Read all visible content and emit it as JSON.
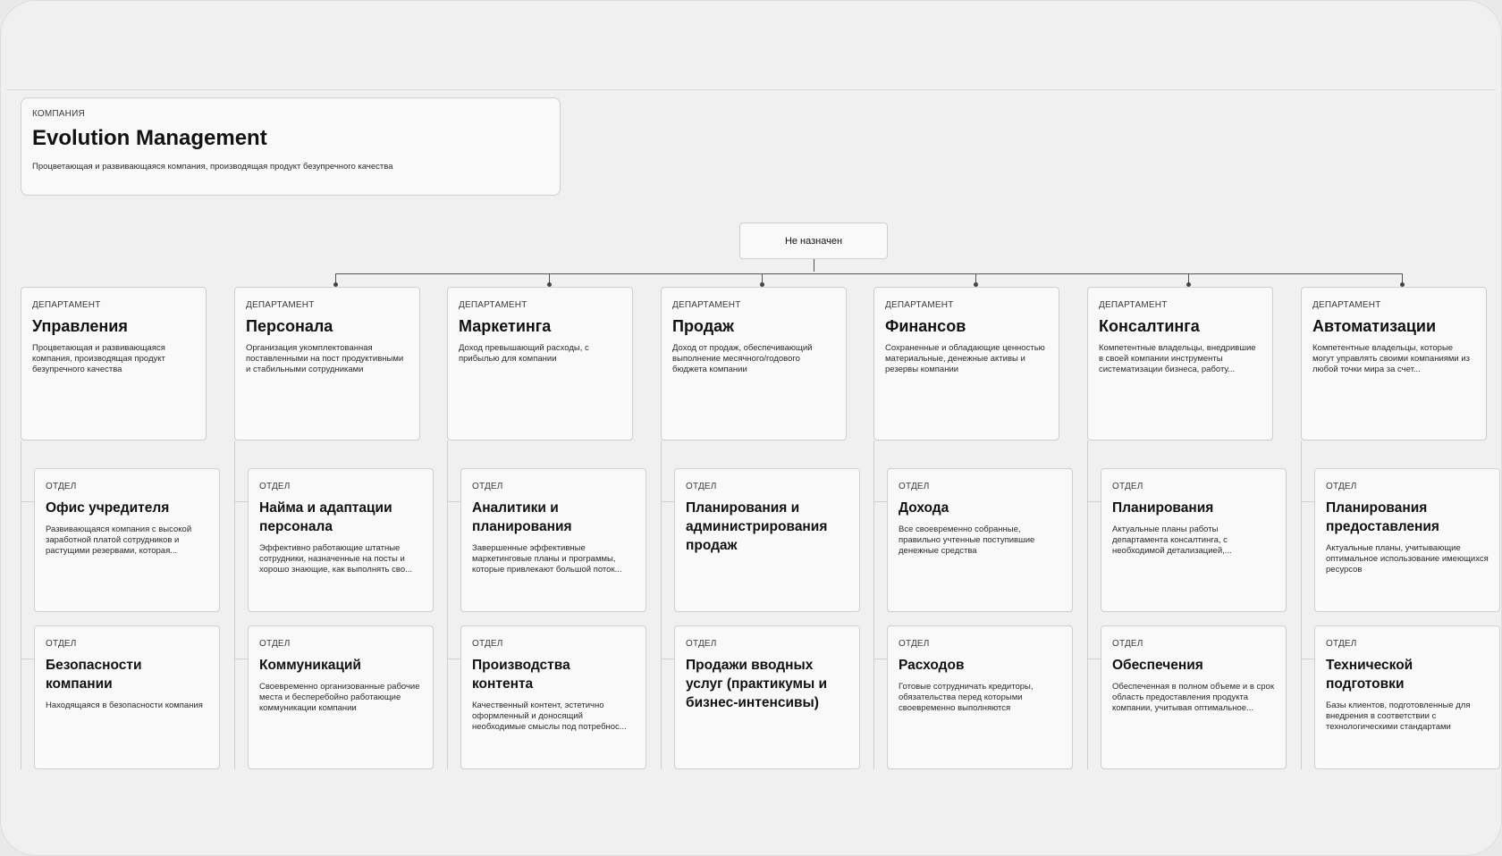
{
  "company": {
    "kind": "КОМПАНИЯ",
    "name": "Evolution Management",
    "description": "Процветающая и развивающаяся компания, производящая продукт безупречного качества"
  },
  "unassigned": "Не назначен",
  "departments": [
    {
      "kind": "ДЕПАРТАМЕНТ",
      "name": "Управления",
      "description": "Процветающая и развивающаяся компания, производящая продукт безупречного качества",
      "units": [
        {
          "kind": "ОТДЕЛ",
          "name": "Офис учредителя",
          "description": "Развивающаяся компания с высокой заработной платой сотрудников и растущими резервами, которая..."
        },
        {
          "kind": "ОТДЕЛ",
          "name": "Безопасности компании",
          "description": "Находящаяся в безопасности компания"
        }
      ]
    },
    {
      "kind": "ДЕПАРТАМЕНТ",
      "name": "Персонала",
      "description": "Организация укомплектованная поставленными на пост продуктивными и стабильными сотрудниками",
      "units": [
        {
          "kind": "ОТДЕЛ",
          "name": "Найма и адаптации персонала",
          "description": "Эффективно работающие штатные сотрудники, назначенные на посты и хорошо знающие, как выполнять сво..."
        },
        {
          "kind": "ОТДЕЛ",
          "name": "Коммуникаций",
          "description": "Своевременно организованные рабочие места и бесперебойно работающие коммуникации компании"
        }
      ]
    },
    {
      "kind": "ДЕПАРТАМЕНТ",
      "name": "Маркетинга",
      "description": "Доход превышающий расходы, с прибылью для компании",
      "units": [
        {
          "kind": "ОТДЕЛ",
          "name": "Аналитики и планирования",
          "description": "Завершенные эффективные маркетинговые планы и программы, которые привлекают большой поток..."
        },
        {
          "kind": "ОТДЕЛ",
          "name": "Производства контента",
          "description": "Качественный контент, эстетично оформленный и доносящий необходимые смыслы под потребнос..."
        }
      ]
    },
    {
      "kind": "ДЕПАРТАМЕНТ",
      "name": "Продаж",
      "description": "Доход от продаж, обеспечивающий выполнение месячного/годового бюджета компании",
      "units": [
        {
          "kind": "ОТДЕЛ",
          "name": "Планирования и администрирования продаж",
          "description": ""
        },
        {
          "kind": "ОТДЕЛ",
          "name": "Продажи вводных услуг (практикумы и бизнес-интенсивы)",
          "description": ""
        }
      ]
    },
    {
      "kind": "ДЕПАРТАМЕНТ",
      "name": "Финансов",
      "description": "Сохраненные и обладающие ценностью материальные, денежные активы и резервы компании",
      "units": [
        {
          "kind": "ОТДЕЛ",
          "name": "Дохода",
          "description": "Все своевременно собранные, правильно учтенные поступившие денежные средства"
        },
        {
          "kind": "ОТДЕЛ",
          "name": "Расходов",
          "description": "Готовые сотрудничать кредиторы, обязательства перед которыми своевременно выполняются"
        }
      ]
    },
    {
      "kind": "ДЕПАРТАМЕНТ",
      "name": "Консалтинга",
      "description": "Компетентные владельцы, внедрившие в своей компании инструменты систематизации бизнеса, работу...",
      "units": [
        {
          "kind": "ОТДЕЛ",
          "name": "Планирования",
          "description": "Актуальные планы работы департамента консалтинга, с необходимой детализацией,..."
        },
        {
          "kind": "ОТДЕЛ",
          "name": "Обеспечения",
          "description": "Обеспеченная в полном объеме и в срок область предоставления продукта компании, учитывая оптимальное..."
        }
      ]
    },
    {
      "kind": "ДЕПАРТАМЕНТ",
      "name": "Автоматизации",
      "description": "Компетентные владельцы, которые могут управлять своими компаниями из любой точки мира за счет...",
      "units": [
        {
          "kind": "ОТДЕЛ",
          "name": "Планирования предоставления",
          "description": "Актуальные планы, учитывающие оптимальное использование имеющихся ресурсов"
        },
        {
          "kind": "ОТДЕЛ",
          "name": "Технической подготовки",
          "description": "Базы клиентов, подготовленные для внедрения в соответствии с технологическими стандартами"
        }
      ]
    }
  ]
}
